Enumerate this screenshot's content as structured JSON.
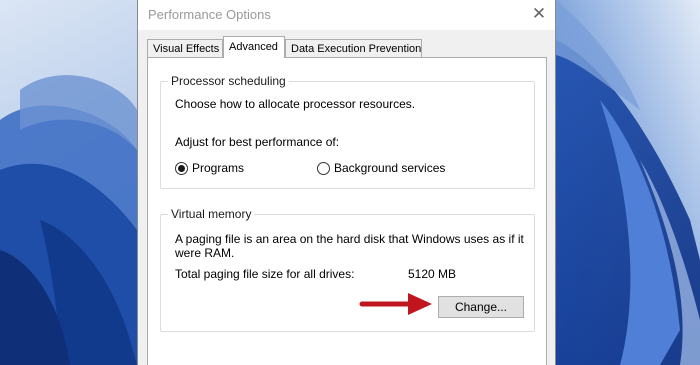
{
  "window": {
    "title": "Performance Options",
    "close_glyph": "✕"
  },
  "tabs": [
    {
      "label": "Visual Effects",
      "active": false
    },
    {
      "label": "Advanced",
      "active": true
    },
    {
      "label": "Data Execution Prevention",
      "active": false
    }
  ],
  "processor_scheduling": {
    "legend": "Processor scheduling",
    "description": "Choose how to allocate processor resources.",
    "adjust_label": "Adjust for best performance of:",
    "options": [
      {
        "label": "Programs",
        "selected": true
      },
      {
        "label": "Background services",
        "selected": false
      }
    ]
  },
  "virtual_memory": {
    "legend": "Virtual memory",
    "description_line1": "A paging file is an area on the hard disk that Windows uses as if it",
    "description_line2": "were RAM.",
    "total_label": "Total paging file size for all drives:",
    "total_value": "5120 MB",
    "change_button": "Change..."
  },
  "annotation": {
    "arrow_color": "#c0161e",
    "arrow_icon": "red-arrow-right-icon"
  },
  "colors": {
    "wallpaper_blue": "#2f5fb0",
    "dialog_bg": "#f0f0f0"
  }
}
